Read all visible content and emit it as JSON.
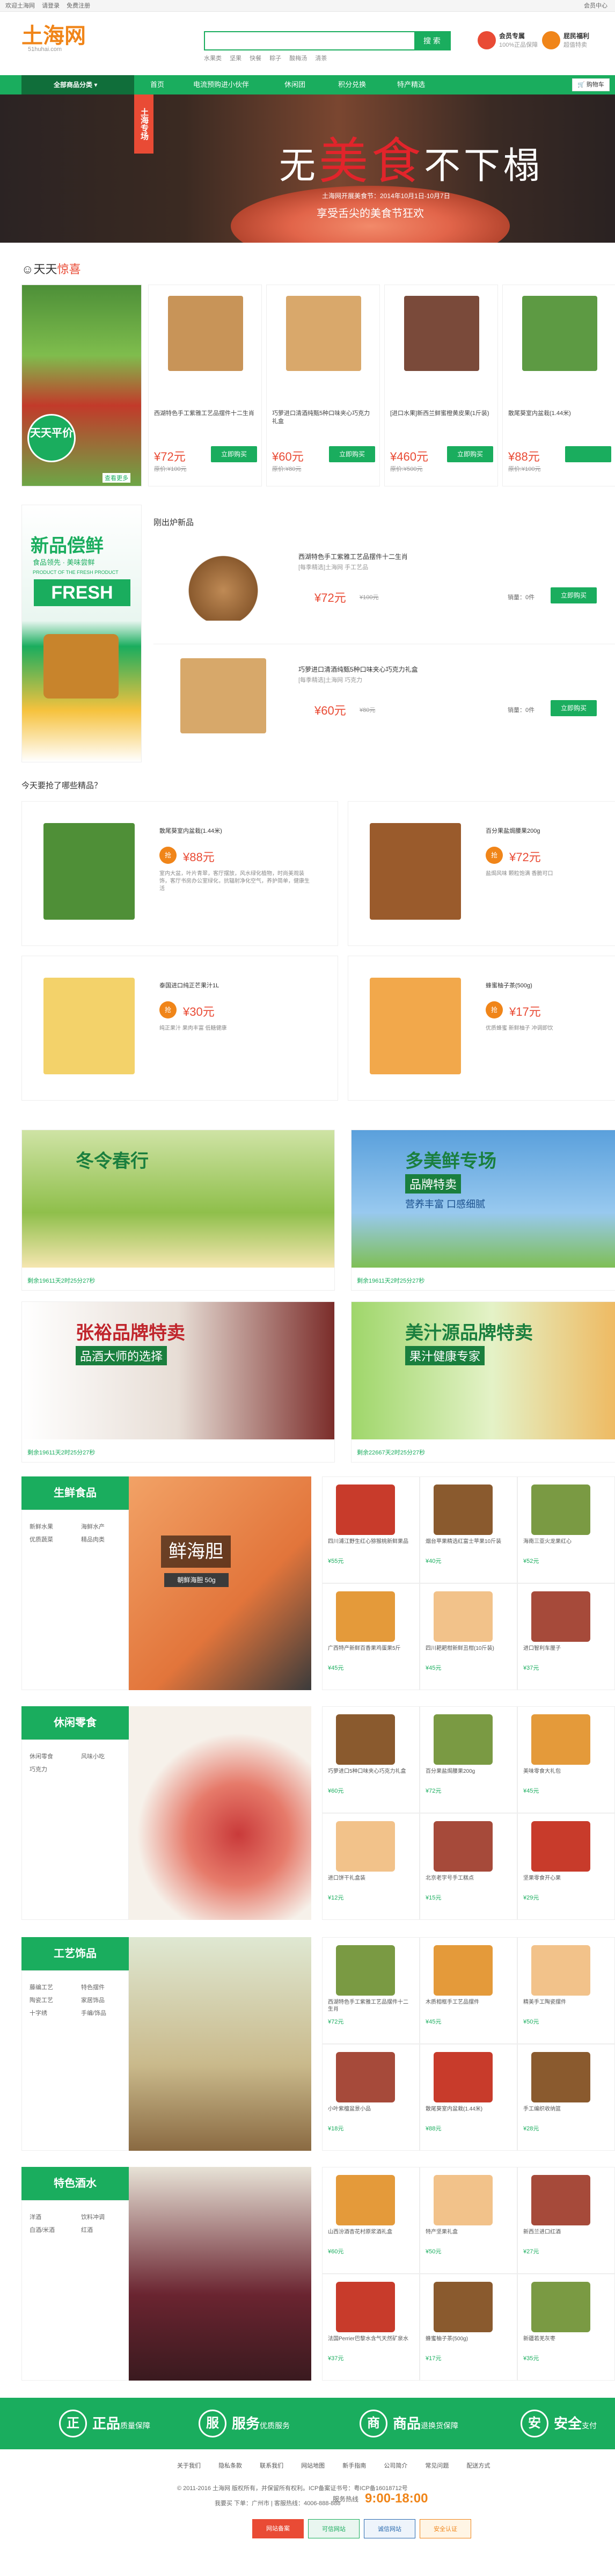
{
  "topbar": {
    "links": [
      "欢迎土海网",
      "请登录",
      "免费注册"
    ],
    "right": "会员中心"
  },
  "header": {
    "logo": "土海网",
    "logo_sub": "51huhai.com",
    "search_placeholder": "",
    "search_button": "搜 索",
    "hotwords": [
      "水果类",
      "坚果",
      "快餐",
      "粽子",
      "酸梅汤",
      "清茶"
    ],
    "badge1_title": "会员专属",
    "badge1_sub": "100%正品保障",
    "badge2_title": "屁民福利",
    "badge2_sub": "超值特卖"
  },
  "nav": {
    "category": "全部商品分类",
    "items": [
      "首页",
      "电流预购进小伙伴",
      "休闲团",
      "积分兑换",
      "特产精选"
    ],
    "cart": "购物车"
  },
  "banner": {
    "tag": "土海专场",
    "title_pre": "无",
    "title_em": "美食",
    "title_post": "不下榻",
    "line1": "土海网开展美食节：2014年10月1日-10月7日",
    "line2": "享受舌尖的美食节狂欢"
  },
  "daily": {
    "title_pre": "天天",
    "title_em": "惊喜",
    "left_badge": "天天平价",
    "left_more": "查看更多",
    "products": [
      {
        "name": "西湖特色手工紫雅工艺品摆件十二生肖",
        "price": "¥72元",
        "old": "原价:¥100元",
        "btn": "立即购买"
      },
      {
        "name": "巧萝进口清酒纯甄5种口味夹心巧克力礼盒",
        "price": "¥60元",
        "old": "原价:¥80元",
        "btn": "立即购买"
      },
      {
        "name": "[进口水果]新西兰鲜蜜橙黄皮果(1斤装)",
        "price": "¥460元",
        "old": "原价:¥500元",
        "btn": "立即购买"
      },
      {
        "name": "散尾葵室内盆栽(1.44米)",
        "price": "¥88元",
        "old": "原价:¥100元",
        "btn": ""
      }
    ]
  },
  "fresh": {
    "left_t1": "新品偿鲜",
    "left_t2": "食品领先 · 美味尝鲜",
    "left_t3": "PRODUCT OF THE FRESH PRODUCT",
    "left_t4": "FRESH",
    "title": "刚出炉新品",
    "items": [
      {
        "name": "西湖特色手工紫雅工艺品摆件十二生肖",
        "sub": "[每季精选]土海网 手工艺品",
        "price": "¥72元",
        "old": "¥100元",
        "sales": "销量：0件",
        "btn": "立即购买"
      },
      {
        "name": "巧萝进口清酒纯甄5种口味夹心巧克力礼盒",
        "sub": "[每季精选]土海网 巧克力",
        "price": "¥60元",
        "old": "¥80元",
        "sales": "销量：0件",
        "btn": "立即购买"
      }
    ]
  },
  "today": {
    "title": "今天要抢了哪些精品？",
    "items": [
      {
        "name": "散尾葵室内盆栽(1.44米)",
        "price": "¥88元",
        "desc": "室内大盆，叶片青翠，客厅摆放，风水绿化植物，时尚美观装饰，客厅书房办公室绿化，抗辐射净化空气，养护简单，健康生活"
      },
      {
        "name": "百分果盐焗腰果200g",
        "price": "¥72元",
        "desc": "盐焗风味 颗粒饱满 香脆可口"
      },
      {
        "name": "泰国进口纯正芒果汁1L",
        "price": "¥30元",
        "desc": "纯正果汁 果肉丰富 低糖健康"
      },
      {
        "name": "蜂蜜柚子茶(500g)",
        "price": "¥17元",
        "desc": "优质蜂蜜 新鲜柚子 冲调即饮"
      }
    ],
    "tag": "抢"
  },
  "specials": [
    {
      "t1": "冬令春行",
      "meta": "剩余19611天2时25分27秒"
    },
    {
      "t1": "多美鲜专场",
      "t2": "品牌特卖",
      "t3": "营养丰富 口感细腻",
      "meta": "剩余19611天2时25分27秒"
    },
    {
      "t1": "张裕品牌特卖",
      "t2": "品酒大师的选择",
      "meta": "剩余19611天2时25分27秒"
    },
    {
      "t1": "美汁源品牌特卖",
      "t2": "果汁健康专家",
      "meta": "剩余22667天2时25分27秒"
    }
  ],
  "floors": [
    {
      "title": "生鲜食品",
      "links": [
        "新鲜水果",
        "海鲜水产",
        "优质蔬菜",
        "精品肉类"
      ],
      "ad_t1": "鲜海胆",
      "ad_t2": "朝鲜海胆 50g",
      "cells": [
        {
          "name": "四川浦江野生红心猕猴桃新鲜果品",
          "price": "¥55元"
        },
        {
          "name": "烟台苹果精选红富士苹果10斤装",
          "price": "¥40元"
        },
        {
          "name": "海南三亚火龙果红心",
          "price": "¥52元"
        },
        {
          "name": "广西特产新鲜百香果鸡蛋果5斤",
          "price": "¥45元"
        },
        {
          "name": "四川耙耙柑新鲜丑柑(10斤装)",
          "price": "¥45元"
        },
        {
          "name": "进口智利车厘子",
          "price": "¥37元"
        }
      ]
    },
    {
      "title": "休闲零食",
      "links": [
        "休闲零食",
        "风味小吃",
        "巧克力",
        ""
      ],
      "ad_t1": "",
      "ad_t2": "",
      "cells": [
        {
          "name": "巧萝进口5种口味夹心巧克力礼盒",
          "price": "¥60元"
        },
        {
          "name": "百分果盐焗腰果200g",
          "price": "¥72元"
        },
        {
          "name": "美味零食大礼包",
          "price": "¥45元"
        },
        {
          "name": "进口饼干礼盒装",
          "price": "¥12元"
        },
        {
          "name": "北京老字号手工糕点",
          "price": "¥15元"
        },
        {
          "name": "坚果零食开心果",
          "price": "¥29元"
        }
      ]
    },
    {
      "title": "工艺饰品",
      "links": [
        "藤编工艺",
        "特色摆件",
        "陶瓷工艺",
        "家居饰品",
        "十字绣",
        "手编/饰品"
      ],
      "ad_t1": "",
      "ad_t2": "",
      "cells": [
        {
          "name": "西湖特色手工紫雅工艺品摆件十二生肖",
          "price": "¥72元"
        },
        {
          "name": "木质相框手工艺品摆件",
          "price": "¥45元"
        },
        {
          "name": "精美手工陶瓷摆件",
          "price": "¥50元"
        },
        {
          "name": "小叶紫檀盆景小品",
          "price": "¥18元"
        },
        {
          "name": "散尾葵室内盆栽(1.44米)",
          "price": "¥88元"
        },
        {
          "name": "手工编织收纳篮",
          "price": "¥28元"
        }
      ]
    },
    {
      "title": "特色酒水",
      "links": [
        "洋酒",
        "饮料冲调",
        "白酒/米酒",
        "红酒"
      ],
      "ad_t1": "",
      "ad_t2": "",
      "cells": [
        {
          "name": "山西汾酒杏花村原浆酒礼盒",
          "price": "¥60元"
        },
        {
          "name": "特产坚果礼盒",
          "price": "¥50元"
        },
        {
          "name": "新西兰进口红酒",
          "price": "¥27元"
        },
        {
          "name": "法国Perrier巴黎水含气天然矿泉水",
          "price": "¥37元"
        },
        {
          "name": "蜂蜜柚子茶(500g)",
          "price": "¥17元"
        },
        {
          "name": "新疆若羌灰枣",
          "price": "¥35元"
        }
      ]
    }
  ],
  "features": [
    {
      "icon": "正",
      "title": "正品",
      "sub": "质量保障"
    },
    {
      "icon": "服",
      "title": "服务",
      "sub": "优质服务"
    },
    {
      "icon": "商",
      "title": "商品",
      "sub": "退换货保障"
    },
    {
      "icon": "安",
      "title": "安全",
      "sub": "支付"
    }
  ],
  "footer": {
    "links": [
      "关于我们",
      "隐私条款",
      "联系我们",
      "网站地图",
      "新手指南",
      "公司简介",
      "常见问题",
      "配送方式"
    ],
    "copyright": "© 2011-2016 土海网 版权所有，并保留所有权利。ICP备案证书号：粤ICP备16018712号",
    "hotline_label": "服务热线",
    "hotline": "9:00-18:00",
    "service_line": "我要买 下单：广州市 | 客服热线：4006-888-888",
    "certs": [
      "网站备案",
      "可信网站",
      "诚信网站",
      "安全认证"
    ]
  },
  "colors": {
    "brand": "#1aad5e",
    "accent": "#e94b35",
    "orange": "#f08519"
  }
}
